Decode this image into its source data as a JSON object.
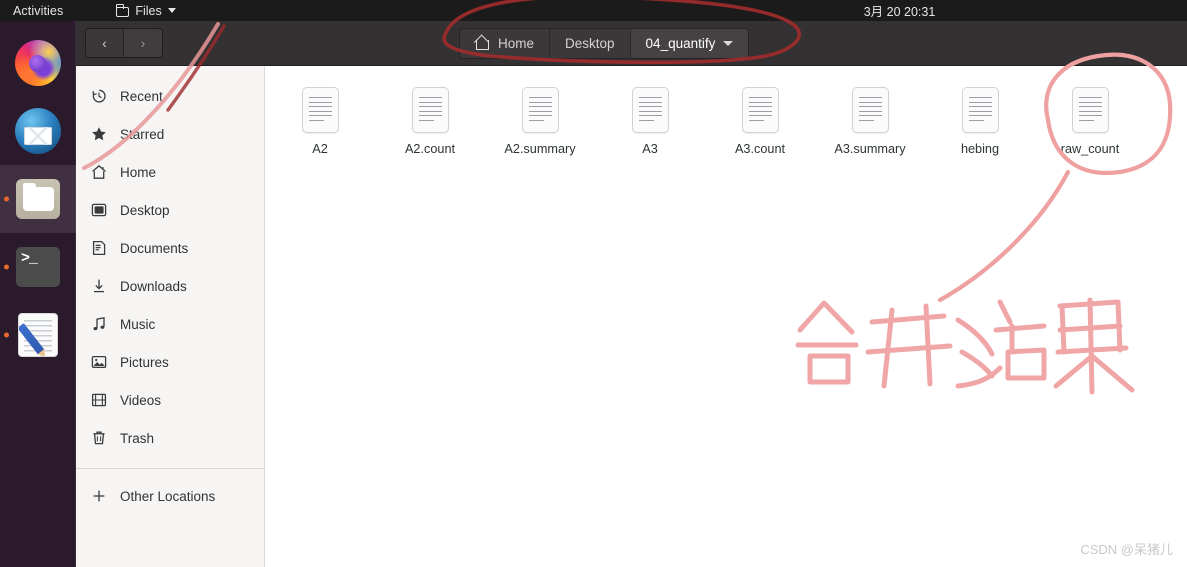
{
  "topbar": {
    "activities": "Activities",
    "app_name": "Files",
    "app_icon": "folder-icon",
    "menu_caret": "chevron-down-icon",
    "clock": "3月 20  20:31"
  },
  "dock": {
    "items": [
      {
        "name": "firefox",
        "label": "Firefox",
        "running": false,
        "active": false
      },
      {
        "name": "thunderbird",
        "label": "Thunderbird Mail",
        "running": false,
        "active": false
      },
      {
        "name": "files",
        "label": "Files",
        "running": true,
        "active": true
      },
      {
        "name": "terminal",
        "label": "Terminal",
        "running": true,
        "active": false
      },
      {
        "name": "text-editor",
        "label": "Text Editor",
        "running": true,
        "active": false
      }
    ],
    "terminal_glyph": ">_",
    "background": "#2b192c"
  },
  "window": {
    "nav": {
      "back": "‹",
      "forward": "›"
    },
    "breadcrumbs": [
      {
        "label": "Home",
        "icon": "home-icon",
        "active": false
      },
      {
        "label": "Desktop",
        "icon": "",
        "active": false
      },
      {
        "label": "04_quantify",
        "icon": "",
        "active": true,
        "caret": "chevron-down-icon"
      }
    ]
  },
  "sidebar": {
    "items": [
      {
        "label": "Recent",
        "icon": "clock-icon"
      },
      {
        "label": "Starred",
        "icon": "star-icon"
      },
      {
        "label": "Home",
        "icon": "home-icon"
      },
      {
        "label": "Desktop",
        "icon": "desktop-icon"
      },
      {
        "label": "Documents",
        "icon": "document-icon"
      },
      {
        "label": "Downloads",
        "icon": "download-icon"
      },
      {
        "label": "Music",
        "icon": "music-note-icon"
      },
      {
        "label": "Pictures",
        "icon": "picture-icon"
      },
      {
        "label": "Videos",
        "icon": "video-film-icon"
      },
      {
        "label": "Trash",
        "icon": "trash-icon"
      }
    ],
    "other_locations": {
      "label": "Other Locations",
      "icon": "plus-icon"
    }
  },
  "files": [
    {
      "name": "A2",
      "type": "text-file"
    },
    {
      "name": "A2.count",
      "type": "text-file"
    },
    {
      "name": "A2.summary",
      "type": "text-file"
    },
    {
      "name": "A3",
      "type": "text-file"
    },
    {
      "name": "A3.count",
      "type": "text-file"
    },
    {
      "name": "A3.summary",
      "type": "text-file"
    },
    {
      "name": "hebing",
      "type": "text-file"
    },
    {
      "name": "raw_count",
      "type": "text-file",
      "highlighted": true
    }
  ],
  "annotations": {
    "handwriting": "合并结果",
    "marker_color": "#ef9a9a",
    "dark_marker_color": "#9e2b2b",
    "circled_items": [
      "raw_count",
      "breadcrumb-bar"
    ]
  },
  "watermark": "CSDN @呆猪儿"
}
